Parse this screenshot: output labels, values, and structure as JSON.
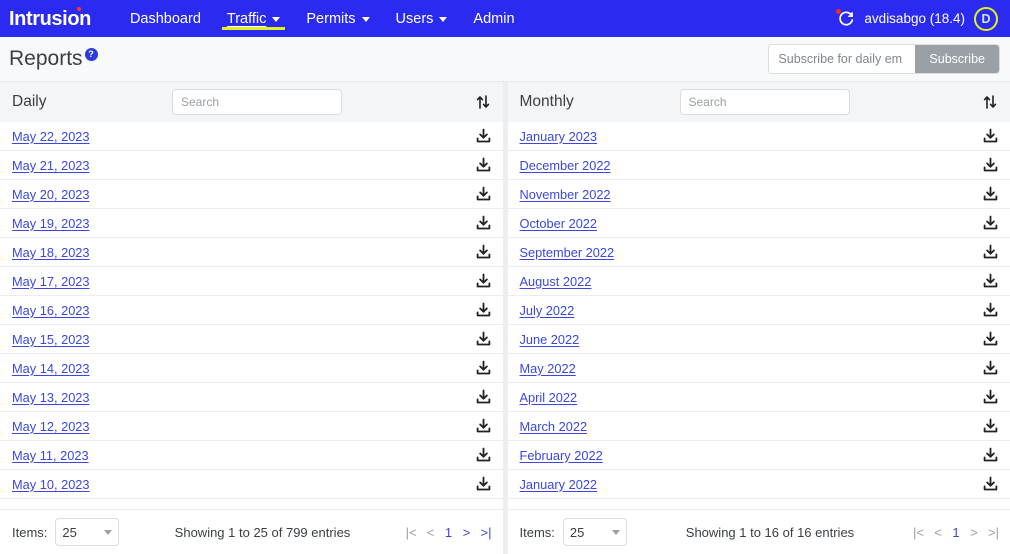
{
  "navbar": {
    "logo": "Intrusion",
    "items": [
      {
        "label": "Dashboard",
        "has_caret": false,
        "active": false
      },
      {
        "label": "Traffic",
        "has_caret": true,
        "active": true
      },
      {
        "label": "Permits",
        "has_caret": true,
        "active": false
      },
      {
        "label": "Users",
        "has_caret": true,
        "active": false
      },
      {
        "label": "Admin",
        "has_caret": false,
        "active": false
      }
    ],
    "refresh_icon": "refresh-icon",
    "username": "avdisabgo (18.4)",
    "avatar_initial": "D",
    "bg_color": "#2a2af0",
    "active_underline_color": "#e3f21a",
    "avatar_ring_color": "#e3f21a"
  },
  "page_header": {
    "title": "Reports",
    "help_badge": "?",
    "subscribe_placeholder": "Subscribe for daily em",
    "subscribe_value": "",
    "subscribe_button": "Subscribe"
  },
  "panels": [
    {
      "title": "Daily",
      "search_placeholder": "Search",
      "search_value": "",
      "sort_icon": "sort-updown-icon",
      "rows": [
        {
          "label": "May 22, 2023",
          "download_icon": "download-icon"
        },
        {
          "label": "May 21, 2023",
          "download_icon": "download-icon"
        },
        {
          "label": "May 20, 2023",
          "download_icon": "download-icon"
        },
        {
          "label": "May 19, 2023",
          "download_icon": "download-icon"
        },
        {
          "label": "May 18, 2023",
          "download_icon": "download-icon"
        },
        {
          "label": "May 17, 2023",
          "download_icon": "download-icon"
        },
        {
          "label": "May 16, 2023",
          "download_icon": "download-icon"
        },
        {
          "label": "May 15, 2023",
          "download_icon": "download-icon"
        },
        {
          "label": "May 14, 2023",
          "download_icon": "download-icon"
        },
        {
          "label": "May 13, 2023",
          "download_icon": "download-icon"
        },
        {
          "label": "May 12, 2023",
          "download_icon": "download-icon"
        },
        {
          "label": "May 11, 2023",
          "download_icon": "download-icon"
        },
        {
          "label": "May 10, 2023",
          "download_icon": "download-icon"
        }
      ],
      "footer": {
        "items_label": "Items:",
        "items_value": "25",
        "showing": "Showing 1 to 25 of 799 entries",
        "pager": {
          "first": "|<",
          "prev": "<",
          "page": "1",
          "next": ">",
          "last": ">|",
          "first_active": false,
          "prev_active": false,
          "next_active": true,
          "last_active": true
        }
      }
    },
    {
      "title": "Monthly",
      "search_placeholder": "Search",
      "search_value": "",
      "sort_icon": "sort-updown-icon",
      "rows": [
        {
          "label": "January 2023",
          "download_icon": "download-icon"
        },
        {
          "label": "December 2022",
          "download_icon": "download-icon"
        },
        {
          "label": "November 2022",
          "download_icon": "download-icon"
        },
        {
          "label": "October 2022",
          "download_icon": "download-icon"
        },
        {
          "label": "September 2022",
          "download_icon": "download-icon"
        },
        {
          "label": "August 2022",
          "download_icon": "download-icon"
        },
        {
          "label": "July 2022",
          "download_icon": "download-icon"
        },
        {
          "label": "June 2022",
          "download_icon": "download-icon"
        },
        {
          "label": "May 2022",
          "download_icon": "download-icon"
        },
        {
          "label": "April 2022",
          "download_icon": "download-icon"
        },
        {
          "label": "March 2022",
          "download_icon": "download-icon"
        },
        {
          "label": "February 2022",
          "download_icon": "download-icon"
        },
        {
          "label": "January 2022",
          "download_icon": "download-icon"
        }
      ],
      "footer": {
        "items_label": "Items:",
        "items_value": "25",
        "showing": "Showing 1 to 16 of 16 entries",
        "pager": {
          "first": "|<",
          "prev": "<",
          "page": "1",
          "next": ">",
          "last": ">|",
          "first_active": false,
          "prev_active": false,
          "next_active": false,
          "last_active": false
        }
      }
    }
  ]
}
